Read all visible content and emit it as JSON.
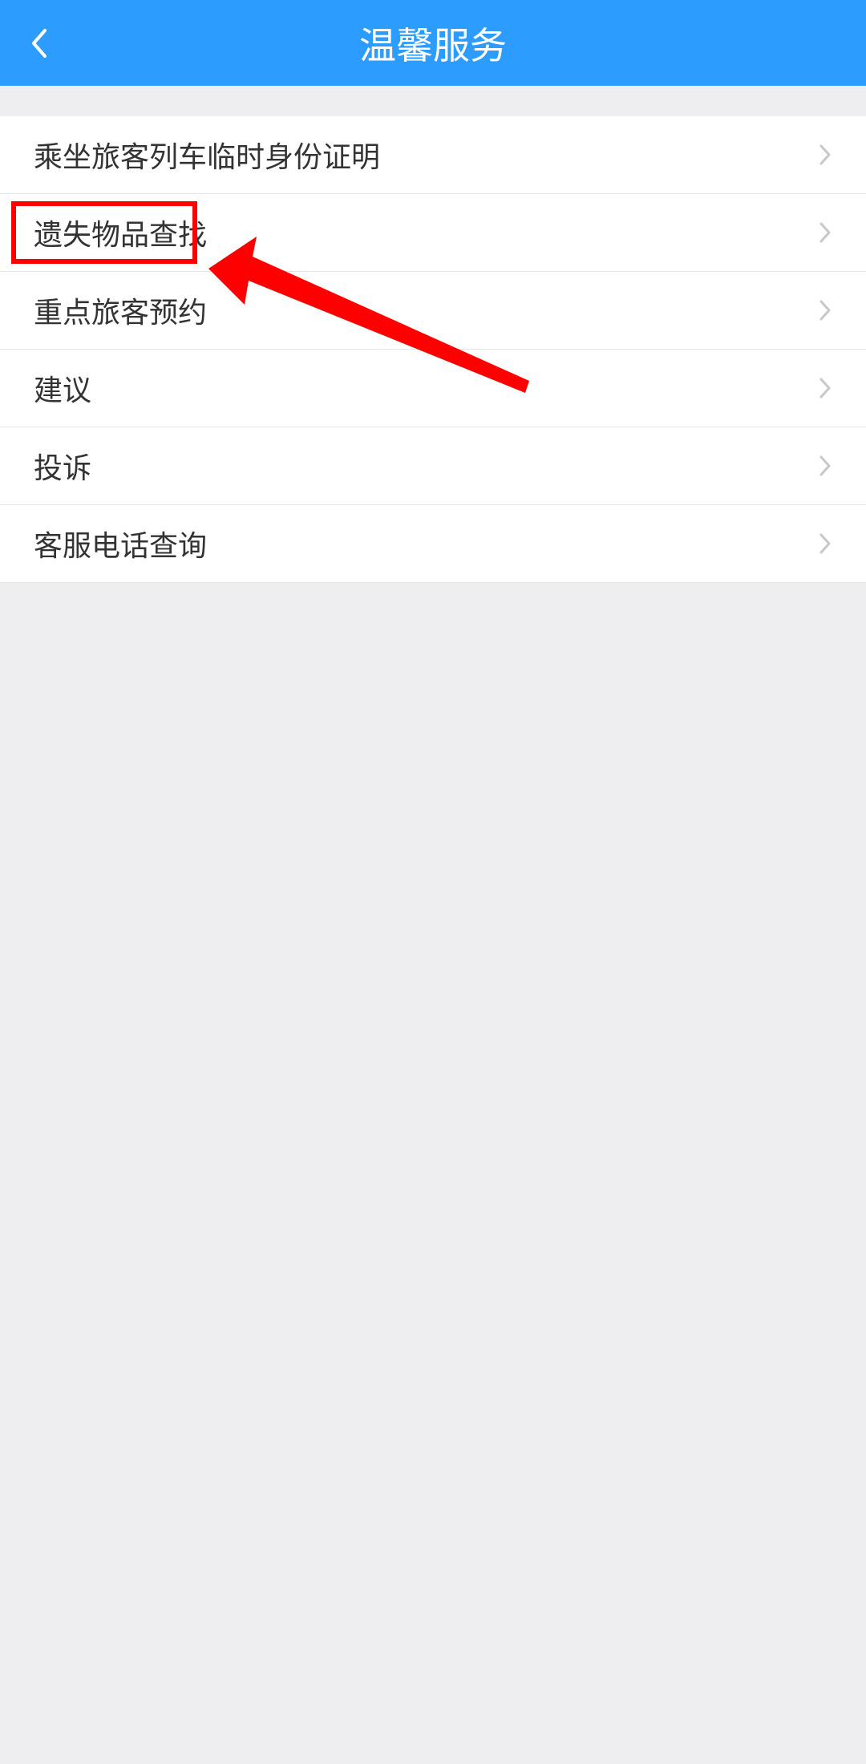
{
  "header": {
    "title": "温馨服务"
  },
  "list": {
    "items": [
      {
        "label": "乘坐旅客列车临时身份证明",
        "name": "temp-id-cert"
      },
      {
        "label": "遗失物品查找",
        "name": "lost-and-found"
      },
      {
        "label": "重点旅客预约",
        "name": "key-passenger-appointment"
      },
      {
        "label": "建议",
        "name": "suggestion"
      },
      {
        "label": "投诉",
        "name": "complaint"
      },
      {
        "label": "客服电话查询",
        "name": "customer-service-phone"
      }
    ]
  }
}
